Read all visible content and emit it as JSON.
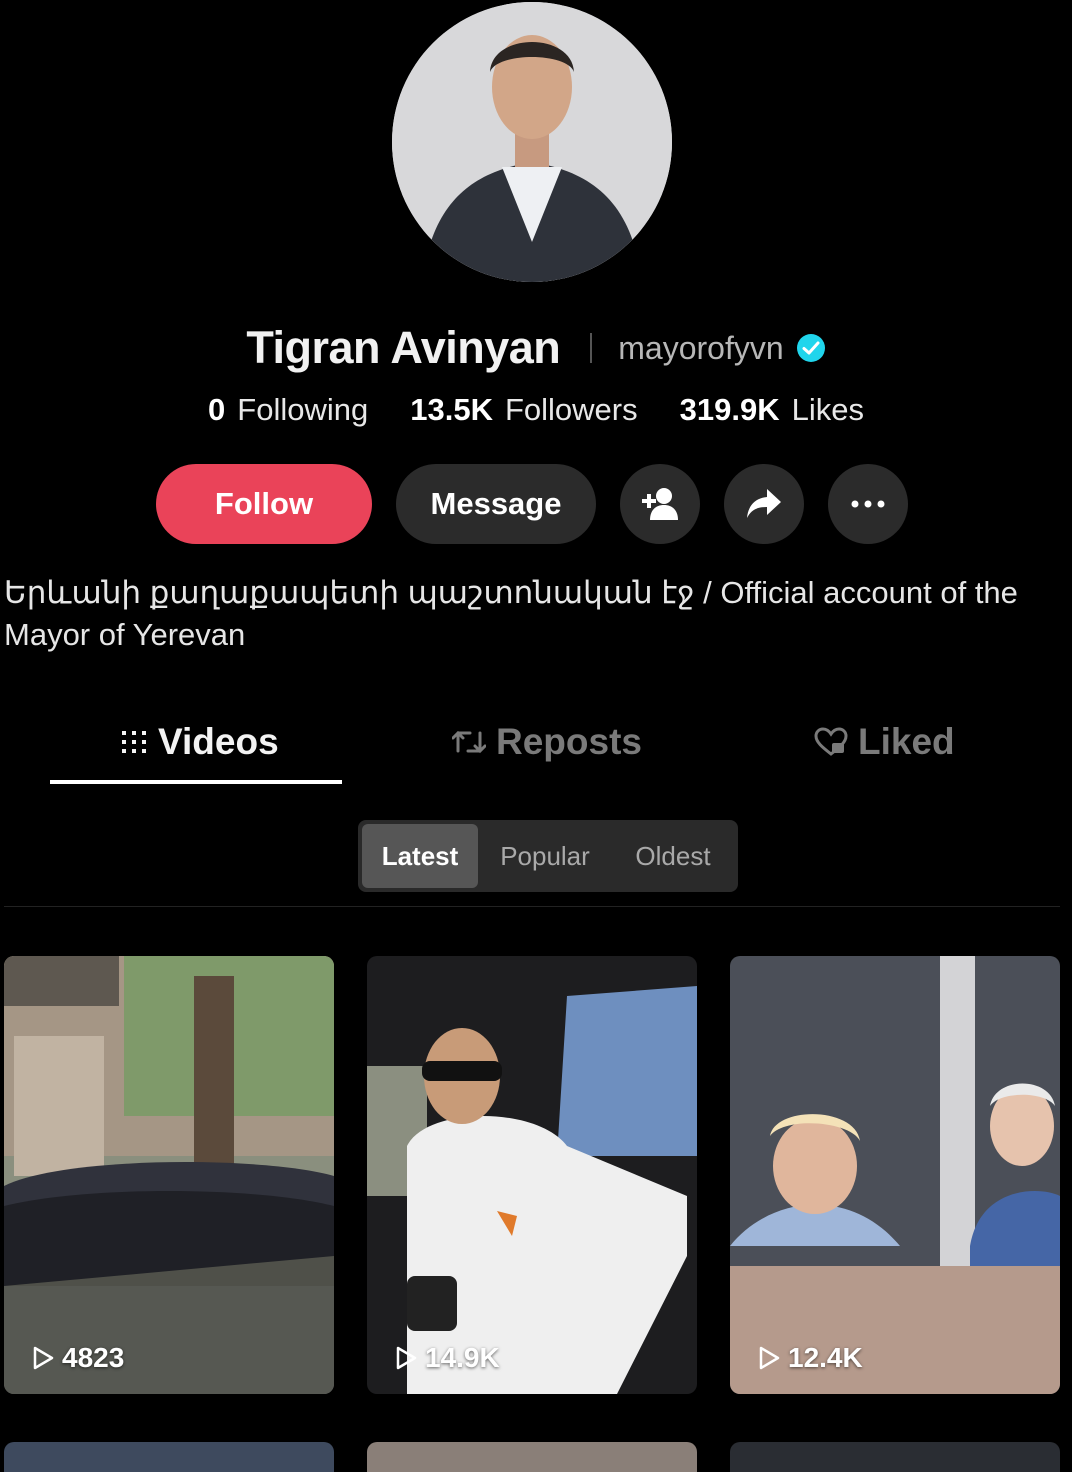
{
  "profile": {
    "display_name": "Tigran Avinyan",
    "username": "mayorofyvn",
    "verified": true,
    "bio": "Երևանի քաղաքապետի պաշտոնական էջ / Official account of the Mayor of Yerevan"
  },
  "stats": {
    "following": {
      "value": "0",
      "label": "Following"
    },
    "followers": {
      "value": "13.5K",
      "label": "Followers"
    },
    "likes": {
      "value": "319.9K",
      "label": "Likes"
    }
  },
  "actions": {
    "follow_label": "Follow",
    "message_label": "Message",
    "icons": [
      "add-friend-icon",
      "share-icon",
      "more-icon"
    ]
  },
  "tabs": [
    {
      "label": "Videos",
      "icon": "grid-icon",
      "active": true
    },
    {
      "label": "Reposts",
      "icon": "repost-icon",
      "active": false
    },
    {
      "label": "Liked",
      "icon": "heart-lock-icon",
      "active": false
    }
  ],
  "sort": {
    "options": [
      "Latest",
      "Popular",
      "Oldest"
    ],
    "selected": "Latest"
  },
  "videos": [
    {
      "views": "4823"
    },
    {
      "views": "14.9K"
    },
    {
      "views": "12.4K"
    }
  ],
  "colors": {
    "background": "#000000",
    "follow_button": "#ea4359",
    "secondary_button": "#2b2b2b",
    "verified_badge": "#20d5ec"
  }
}
